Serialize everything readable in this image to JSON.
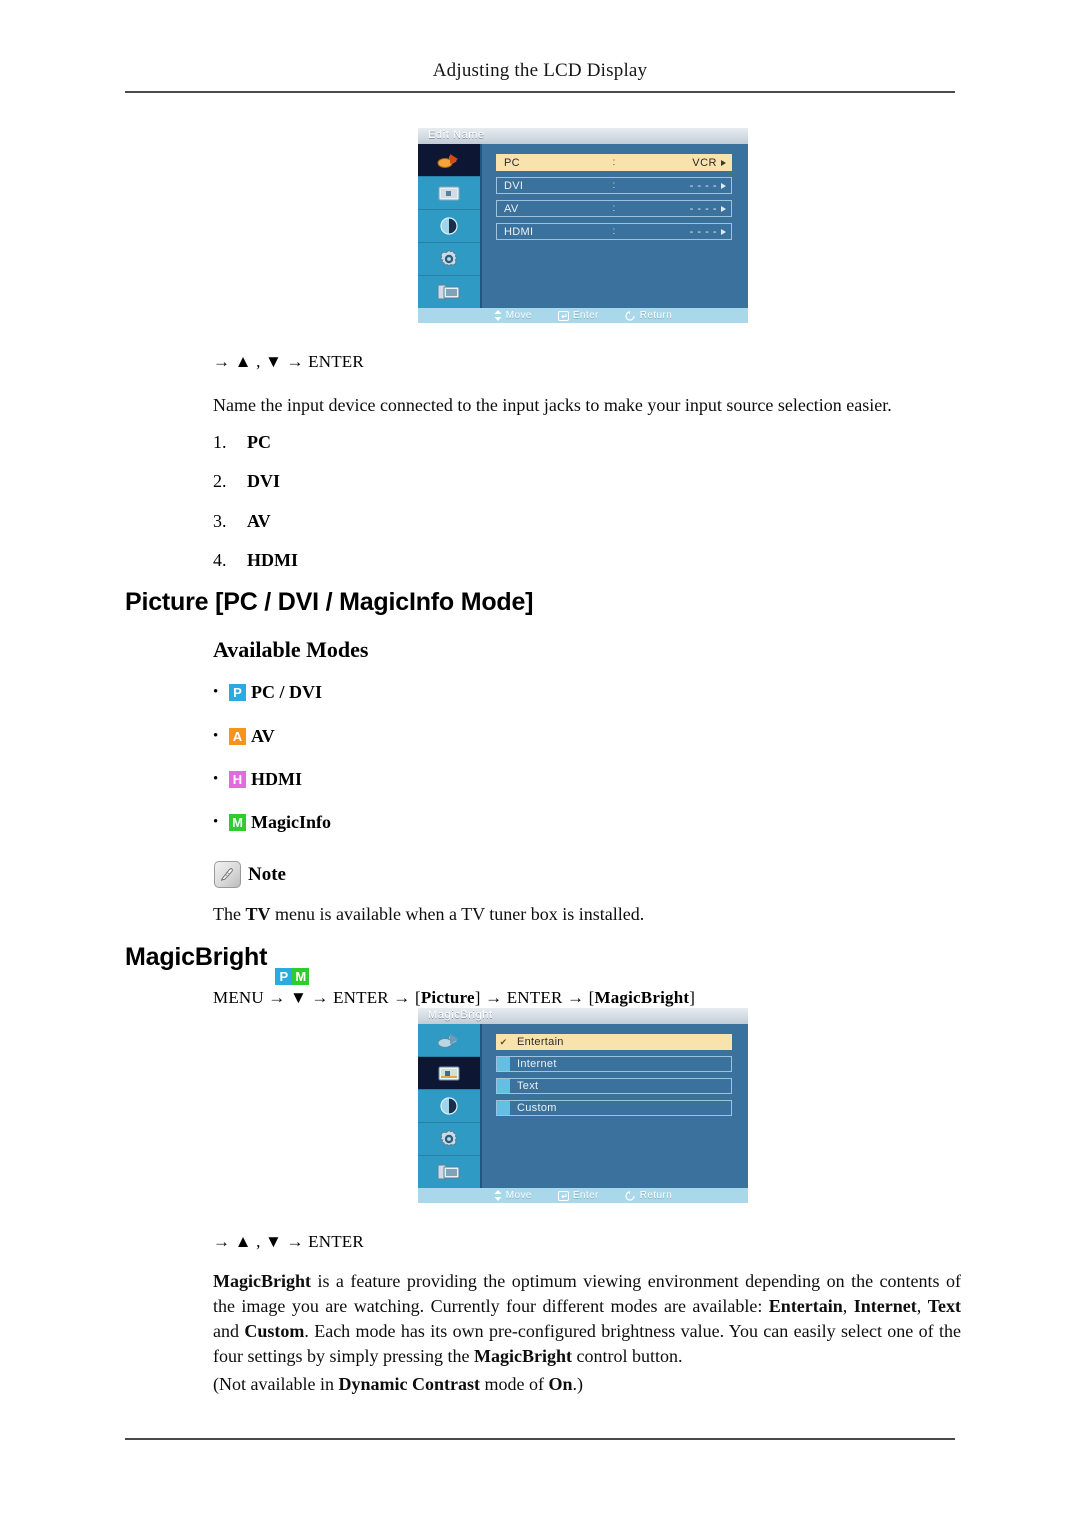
{
  "header": {
    "running_head": "Adjusting the LCD Display"
  },
  "osd_edit_name": {
    "title": "Edit Name",
    "sidebar_icons": [
      "input-source-icon",
      "picture-icon",
      "contrast-icon",
      "setup-gear-icon",
      "multi-control-icon"
    ],
    "selected_sidebar_index": 0,
    "rows": [
      {
        "label": "PC",
        "separator": ":",
        "value": "VCR",
        "selected": true
      },
      {
        "label": "DVI",
        "separator": ":",
        "value": "- - - -",
        "selected": false
      },
      {
        "label": "AV",
        "separator": ":",
        "value": "- - - -",
        "selected": false
      },
      {
        "label": "HDMI",
        "separator": ":",
        "value": "- - - -",
        "selected": false
      }
    ],
    "footer": {
      "move": "Move",
      "enter": "Enter",
      "return": "Return"
    }
  },
  "nav_hint_1": "→ ▲ , ▼ → ENTER",
  "intro_paragraph": "Name the input device connected to the input jacks to make your input source selection easier.",
  "numbered_list": [
    {
      "num": "1.",
      "text": "PC"
    },
    {
      "num": "2.",
      "text": "DVI"
    },
    {
      "num": "3.",
      "text": "AV"
    },
    {
      "num": "4.",
      "text": "HDMI"
    }
  ],
  "picture_section": {
    "heading": "Picture [PC / DVI / MagicInfo Mode]",
    "available_modes_heading": "Available Modes",
    "modes": [
      {
        "badge": "P",
        "badge_color": "#29abe2",
        "label": "PC / DVI"
      },
      {
        "badge": "A",
        "badge_color": "#f7931e",
        "label": "AV"
      },
      {
        "badge": "H",
        "badge_color": "#e06ce0",
        "label": "HDMI"
      },
      {
        "badge": "M",
        "badge_color": "#2ecc2e",
        "label": "MagicInfo"
      }
    ]
  },
  "note": {
    "icon": "note-pen-icon",
    "label": "Note",
    "text_before": "The ",
    "text_bold": "TV",
    "text_after": " menu is available when a TV tuner box is installed."
  },
  "magicbright_section": {
    "heading": "MagicBright",
    "badges": [
      {
        "letter": "P",
        "color": "#29abe2"
      },
      {
        "letter": "M",
        "color": "#2ecc2e"
      }
    ],
    "menu_path": "MENU → ▼ → ENTER → [Picture] → ENTER → [MagicBright]",
    "nav_hint": "→ ▲ , ▼ → ENTER"
  },
  "osd_magicbright": {
    "title": "MagicBright",
    "sidebar_icons": [
      "input-source-icon",
      "picture-icon",
      "contrast-icon",
      "setup-gear-icon",
      "multi-control-icon"
    ],
    "selected_sidebar_index": 1,
    "rows": [
      {
        "label": "Entertain",
        "selected": true,
        "check": "✔"
      },
      {
        "label": "Internet",
        "selected": false,
        "check": ""
      },
      {
        "label": "Text",
        "selected": false,
        "check": ""
      },
      {
        "label": "Custom",
        "selected": false,
        "check": ""
      }
    ],
    "footer": {
      "move": "Move",
      "enter": "Enter",
      "return": "Return"
    }
  },
  "body_paragraph": {
    "part1": "MagicBright",
    "part2": " is a feature providing the optimum viewing environment depending on the contents of the image you are watching. Currently four different modes are available: ",
    "part3": "Entertain",
    "part4": ", ",
    "part5": "Internet",
    "part6": ", ",
    "part7": "Text",
    "part8": " and ",
    "part9": "Custom",
    "part10": ". Each mode has its own pre-configured brightness value. You can easily select one of the four settings by simply pressing the ",
    "part11": "MagicBright",
    "part12": " control button."
  },
  "closing_note": {
    "part1": "(Not available in ",
    "part2": "Dynamic Contrast",
    "part3": " mode of ",
    "part4": "On",
    "part5": ".)"
  }
}
